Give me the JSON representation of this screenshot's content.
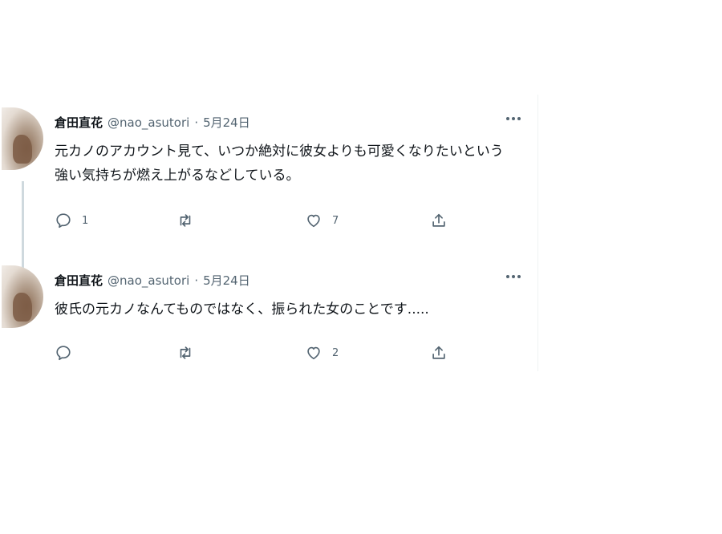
{
  "tweets": [
    {
      "author_name": "倉田直花",
      "author_handle": "@nao_asutori",
      "separator": "·",
      "date": "5月24日",
      "text_lines": [
        "元カノのアカウント見て、いつか絶対に彼女よりも可愛くなりたいという",
        "強い気持ちが燃え上がるなどしている。"
      ],
      "reply_count": "1",
      "retweet_count": "",
      "like_count": "7",
      "more_icon": "more-horizontal-icon"
    },
    {
      "author_name": "倉田直花",
      "author_handle": "@nao_asutori",
      "separator": "·",
      "date": "5月24日",
      "text_lines": [
        "彼氏の元カノなんてものではなく、振られた女のことです....."
      ],
      "reply_count": "",
      "retweet_count": "",
      "like_count": "2",
      "more_icon": "more-horizontal-icon"
    }
  ],
  "icons": {
    "reply": "comment-bubble-icon",
    "retweet": "retweet-arrows-icon",
    "like": "heart-icon",
    "share": "share-upload-icon"
  },
  "colors": {
    "text_primary": "#0f1419",
    "text_secondary": "#536471",
    "thread_line": "#cfd9de"
  }
}
